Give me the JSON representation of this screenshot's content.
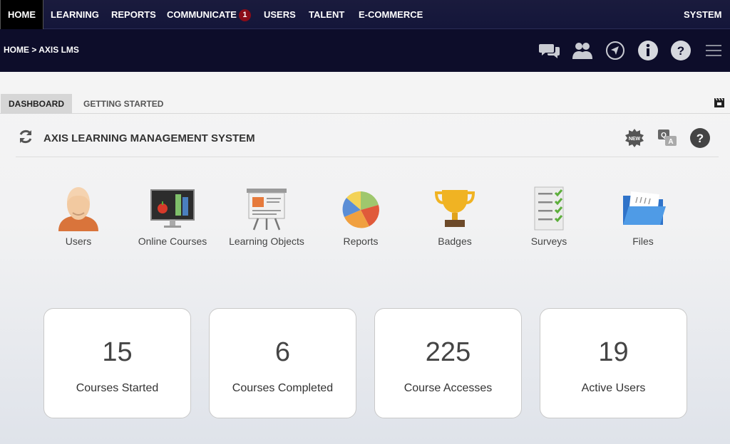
{
  "topnav": {
    "items": [
      {
        "label": "HOME"
      },
      {
        "label": "LEARNING"
      },
      {
        "label": "REPORTS"
      },
      {
        "label": "COMMUNICATE",
        "badge": "1"
      },
      {
        "label": "USERS"
      },
      {
        "label": "TALENT"
      },
      {
        "label": "E-COMMERCE"
      }
    ],
    "right_label": "SYSTEM"
  },
  "breadcrumb": "HOME > AXIS LMS",
  "toolbar_icons": [
    "chat-icon",
    "users-group-icon",
    "navigate-icon",
    "info-icon",
    "help-icon",
    "hamburger-menu-icon"
  ],
  "tabs": [
    {
      "label": "DASHBOARD"
    },
    {
      "label": "GETTING STARTED"
    }
  ],
  "section": {
    "title": "AXIS LEARNING MANAGEMENT SYSTEM",
    "new_badge": "NEW"
  },
  "apps": [
    {
      "label": "Users",
      "icon": "user-avatar-icon"
    },
    {
      "label": "Online Courses",
      "icon": "classroom-board-icon"
    },
    {
      "label": "Learning Objects",
      "icon": "presentation-easel-icon"
    },
    {
      "label": "Reports",
      "icon": "pie-chart-icon"
    },
    {
      "label": "Badges",
      "icon": "trophy-icon"
    },
    {
      "label": "Surveys",
      "icon": "checklist-icon"
    },
    {
      "label": "Files",
      "icon": "folder-icon"
    }
  ],
  "stats": [
    {
      "value": "15",
      "label": "Courses Started"
    },
    {
      "value": "6",
      "label": "Courses Completed"
    },
    {
      "value": "225",
      "label": "Course Accesses"
    },
    {
      "value": "19",
      "label": "Active Users"
    }
  ],
  "colors": {
    "nav_bg": "#1a1b3d",
    "subbar_bg": "#0d0d2a",
    "badge": "#8a0c18"
  }
}
